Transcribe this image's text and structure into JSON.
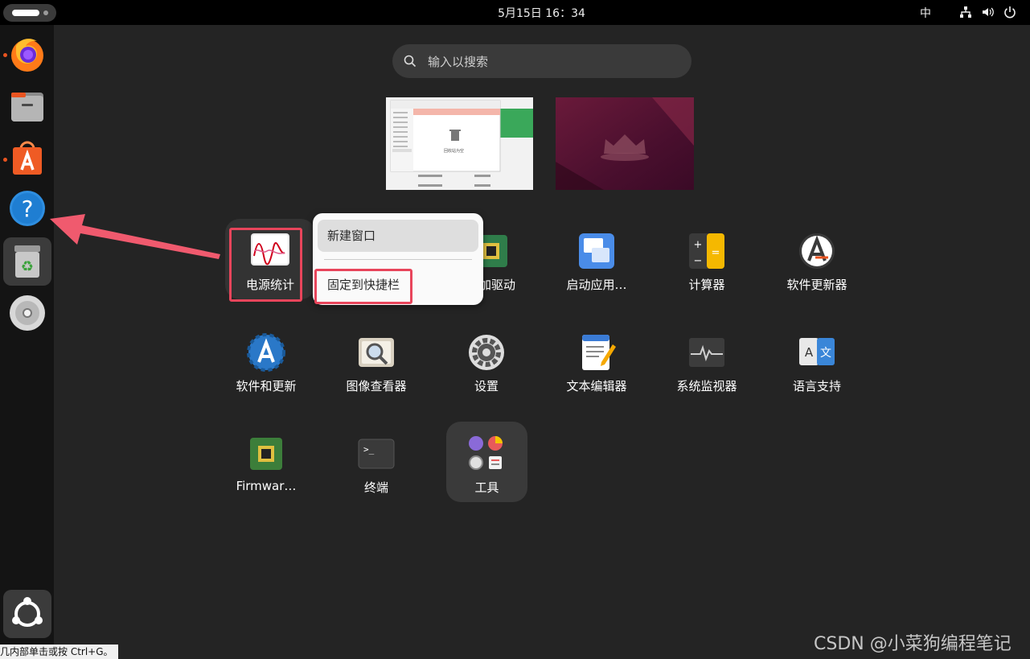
{
  "topbar": {
    "clock": "5月15日  16：34",
    "input_method": "中",
    "tray_icons": [
      "network-icon",
      "volume-icon",
      "power-icon"
    ]
  },
  "dock": {
    "items": [
      {
        "name": "firefox",
        "running": true,
        "active": false
      },
      {
        "name": "files",
        "running": false,
        "active": false
      },
      {
        "name": "app-center",
        "running": true,
        "active": false
      },
      {
        "name": "help",
        "running": false,
        "active": false
      },
      {
        "name": "trash",
        "running": true,
        "active": true
      },
      {
        "name": "disc",
        "running": false,
        "active": false
      }
    ],
    "show_apps": "ubuntu-logo-icon"
  },
  "search": {
    "placeholder": "输入以搜索"
  },
  "apps": [
    {
      "label": "电源统计",
      "icon": "power-statistics-icon"
    },
    {
      "label": "附加驱动",
      "icon": "driver-chip-icon"
    },
    {
      "label": "启动应用…",
      "icon": "startup-apps-icon"
    },
    {
      "label": "计算器",
      "icon": "calculator-icon"
    },
    {
      "label": "软件更新器",
      "icon": "software-updater-icon"
    },
    {
      "label": "软件和更新",
      "icon": "software-properties-icon"
    },
    {
      "label": "图像查看器",
      "icon": "image-viewer-icon"
    },
    {
      "label": "设置",
      "icon": "settings-gear-icon"
    },
    {
      "label": "文本编辑器",
      "icon": "text-editor-icon"
    },
    {
      "label": "系统监视器",
      "icon": "system-monitor-icon"
    },
    {
      "label": "语言支持",
      "icon": "language-support-icon"
    },
    {
      "label": "Firmwar…",
      "icon": "firmware-chip-icon"
    },
    {
      "label": "终端",
      "icon": "terminal-icon"
    },
    {
      "label": "工具",
      "icon": "folder-icon"
    }
  ],
  "context_menu": {
    "new_window": "新建窗口",
    "pin_to_dock": "固定到快捷栏"
  },
  "workspace_thumb": {
    "trash_empty": "回收站为空"
  },
  "statusbar": {
    "text": "几内部单击或按 Ctrl+G。"
  },
  "watermark": "CSDN @小菜狗编程笔记",
  "colors": {
    "accent": "#e95420",
    "highlight_box": "#e8455b"
  }
}
